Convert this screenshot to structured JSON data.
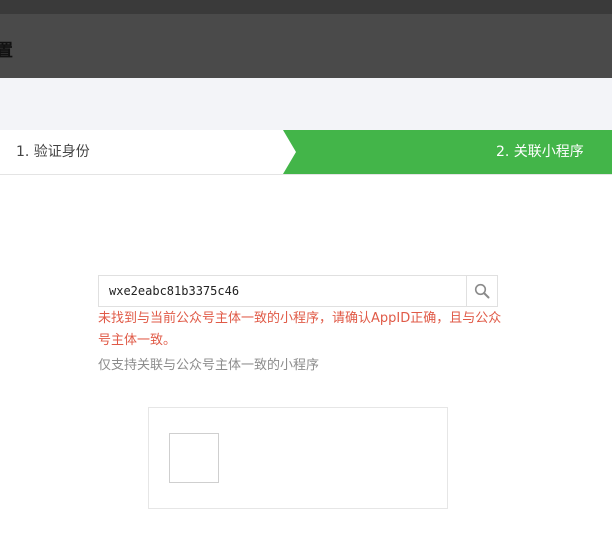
{
  "header": {
    "title": "置"
  },
  "steps": {
    "step1": "1. 验证身份",
    "step2": "2. 关联小程序",
    "active_color": "#43b549"
  },
  "search": {
    "value": "wxe2eabc81b3375c46",
    "icon": "search-icon"
  },
  "messages": {
    "error": "未找到与当前公众号主体一致的小程序，请确认AppID正确，且与公众号主体一致。",
    "hint": "仅支持关联与公众号主体一致的小程序"
  }
}
